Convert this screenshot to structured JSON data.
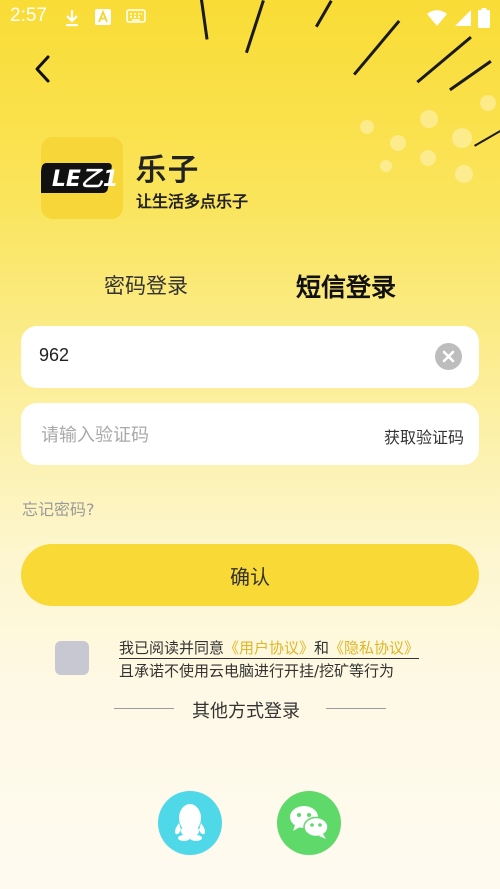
{
  "status_bar": {
    "time": "2:57"
  },
  "header": {
    "back_icon": "chevron-left-icon"
  },
  "app": {
    "name": "乐子",
    "slogan": "让生活多点乐子"
  },
  "tabs": [
    {
      "label": "密码登录",
      "active": false
    },
    {
      "label": "短信登录",
      "active": true
    }
  ],
  "phone_field": {
    "value": "962"
  },
  "code_field": {
    "placeholder": "请输入验证码",
    "action_label": "获取验证码"
  },
  "forgot_label": "忘记密码?",
  "confirm_label": "确认",
  "agreement": {
    "prefix": "我已阅读并同意",
    "user_agreement": "《用户协议》",
    "conjunction": "和",
    "privacy_policy": "《隐私协议》",
    "line2": "且承诺不使用云电脑进行开挂/挖矿等行为",
    "checked": false
  },
  "other_login": {
    "title": "其他方式登录",
    "options": [
      {
        "icon": "qq-icon",
        "color": "#4fd8e8"
      },
      {
        "icon": "wechat-icon",
        "color": "#5fd96a"
      }
    ]
  },
  "colors": {
    "brand_yellow": "#f8d936",
    "link": "#e0b625"
  }
}
